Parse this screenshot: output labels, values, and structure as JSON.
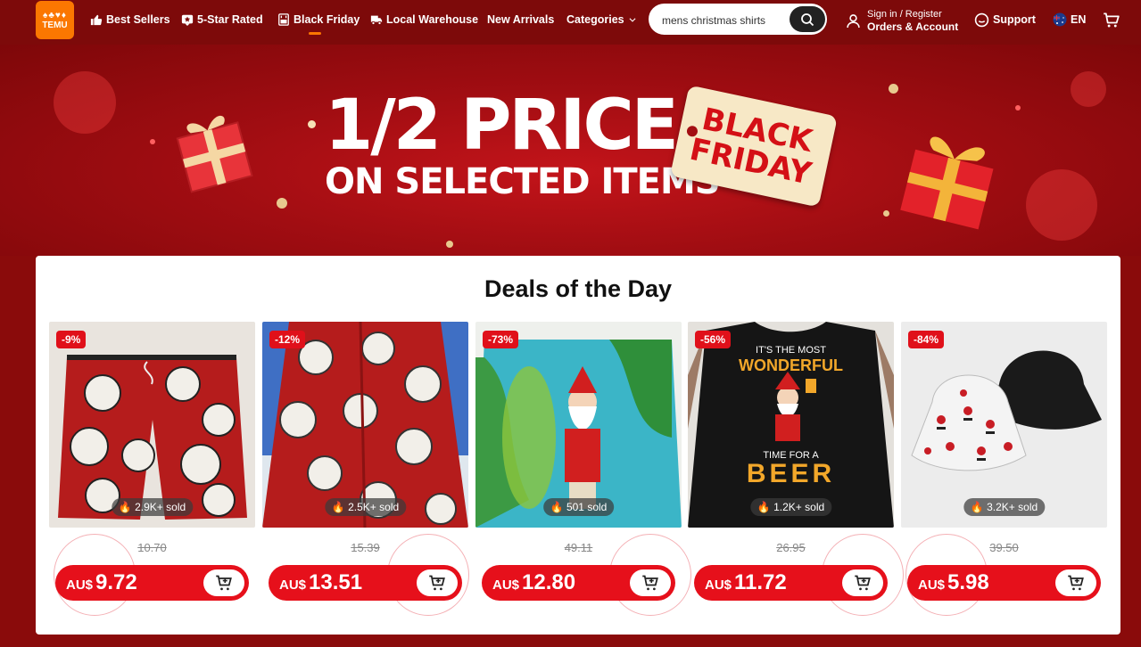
{
  "brand": {
    "logo_symbols": "♠♣♥♦",
    "logo_text": "TEMU",
    "accent": "#fb7701"
  },
  "nav": {
    "items": [
      {
        "label": "Best Sellers",
        "icon": "thumbs-up-icon"
      },
      {
        "label": "5-Star Rated",
        "icon": "star-badge-icon"
      },
      {
        "label": "Black Friday",
        "icon": "black-friday-icon"
      },
      {
        "label": "Local Warehouse",
        "icon": "truck-icon"
      },
      {
        "label": "New Arrivals",
        "icon": ""
      },
      {
        "label": "Categories",
        "icon": "chevron-down-icon"
      }
    ]
  },
  "search": {
    "value": "mens christmas shirts",
    "icon": "search-icon"
  },
  "account": {
    "line1": "Sign in / Register",
    "line2": "Orders & Account"
  },
  "support": {
    "label": "Support"
  },
  "language": {
    "label": "EN",
    "flag": "australia-flag-icon"
  },
  "banner": {
    "headline": "1/2 PRICE",
    "subline": "ON SELECTED ITEMS",
    "tag_line1": "BLACK",
    "tag_line2": "FRIDAY"
  },
  "deals": {
    "title": "Deals of the Day",
    "currency": "AU$",
    "products": [
      {
        "discount": "-9%",
        "sold": "2.9K+ sold",
        "orig_price": "10.70",
        "price": "9.72"
      },
      {
        "discount": "-12%",
        "sold": "2.5K+ sold",
        "orig_price": "15.39",
        "price": "13.51"
      },
      {
        "discount": "-73%",
        "sold": "501 sold",
        "orig_price": "49.11",
        "price": "12.80"
      },
      {
        "discount": "-56%",
        "sold": "1.2K+ sold",
        "orig_price": "26.95",
        "price": "11.72",
        "shirt_text_top": "IT'S THE MOST",
        "shirt_text_mid": "WONDERFUL",
        "shirt_text_low": "TIME FOR A",
        "shirt_text_big": "BEER"
      },
      {
        "discount": "-84%",
        "sold": "3.2K+ sold",
        "orig_price": "39.50",
        "price": "5.98"
      }
    ]
  }
}
